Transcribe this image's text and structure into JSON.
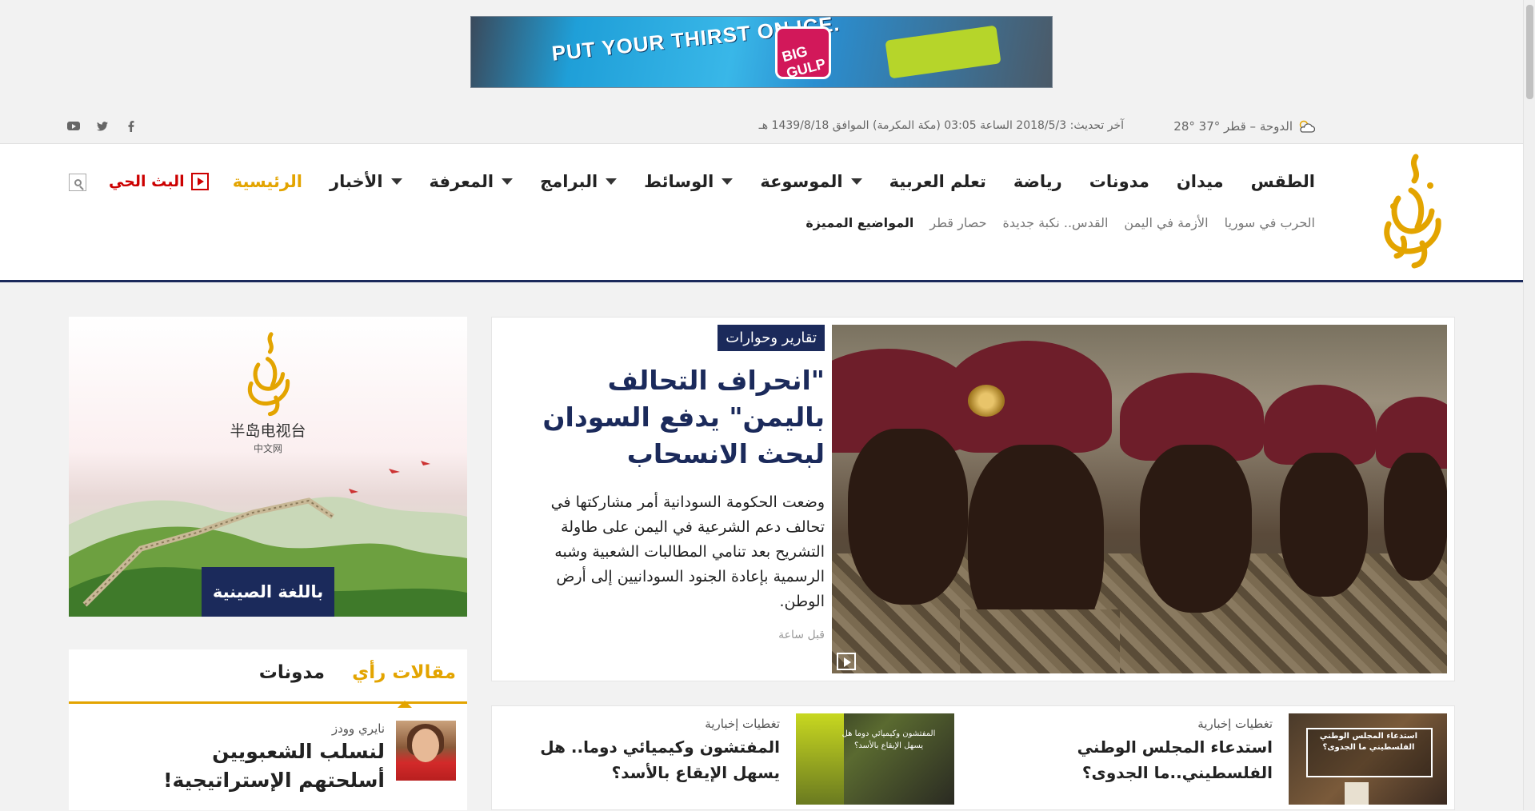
{
  "ad": {
    "banner_text": "PUT YOUR THIRST ON ICE.",
    "cup_text": "BIG GULP"
  },
  "infobar": {
    "weather": "الدوحة – قطر °37 °28",
    "update": "آخر تحديث: 2018/5/3 الساعة 03:05 (مكة المكرمة) الموافق 1439/8/18 هـ",
    "social": [
      "facebook-icon",
      "twitter-icon",
      "youtube-icon"
    ]
  },
  "header": {
    "nav": {
      "home": "الرئيسية",
      "news": "الأخبار",
      "knowledge": "المعرفة",
      "programs": "البرامج",
      "media": "الوسائط",
      "encyclopedia": "الموسوعة",
      "learn_arabic": "تعلم العربية",
      "sports": "رياضة",
      "blogs": "مدونات",
      "midan": "ميدان",
      "weather": "الطقس"
    },
    "live_label": "البث الحي",
    "featured": {
      "label": "المواضيع المميزة",
      "items": [
        "حصار قطر",
        "القدس.. نكبة جديدة",
        "الأزمة في اليمن",
        "الحرب في سوريا"
      ]
    }
  },
  "hero": {
    "tag": "تقارير وحوارات",
    "title": "\"انحراف التحالف باليمن\" يدفع السودان لبحث الانسحاب",
    "description": "وضعت الحكومة السودانية أمر مشاركتها في تحالف دعم الشرعية في اليمن على طاولة التشريح بعد تنامي المطالبات الشعبية وشبه الرسمية بإعادة الجنود السودانيين إلى أرض الوطن.",
    "time": "قبل ساعة"
  },
  "cards": [
    {
      "category": "تغطيات إخبارية",
      "title": "استدعاء المجلس الوطني الفلسطيني..ما الجدوى؟",
      "image_caption": "استدعاء المجلس الوطني الفلسطيني ما الجدوى؟"
    },
    {
      "category": "تغطيات إخبارية",
      "title": "المفتشون وكيميائي دوما.. هل يسهل الإيقاع بالأسد؟",
      "image_caption": "المفتشون وكيميائي دوما هل يسهل الإيقاع بالأسد؟"
    }
  ],
  "sidebar": {
    "ad": {
      "chinese_name": "半岛电视台",
      "chinese_sub": "中文网",
      "button": "باللغة الصينية"
    },
    "opinion": {
      "tab_active": "مقالات رأي",
      "tab_other": "مدونات",
      "author": "نايري وودز",
      "title": "لنسلب الشعبويين أسلحتهم الإستراتيجية!"
    }
  },
  "colors": {
    "brand_gold": "#e3a400",
    "brand_navy": "#1b2a5b",
    "live_red": "#cc0000"
  }
}
